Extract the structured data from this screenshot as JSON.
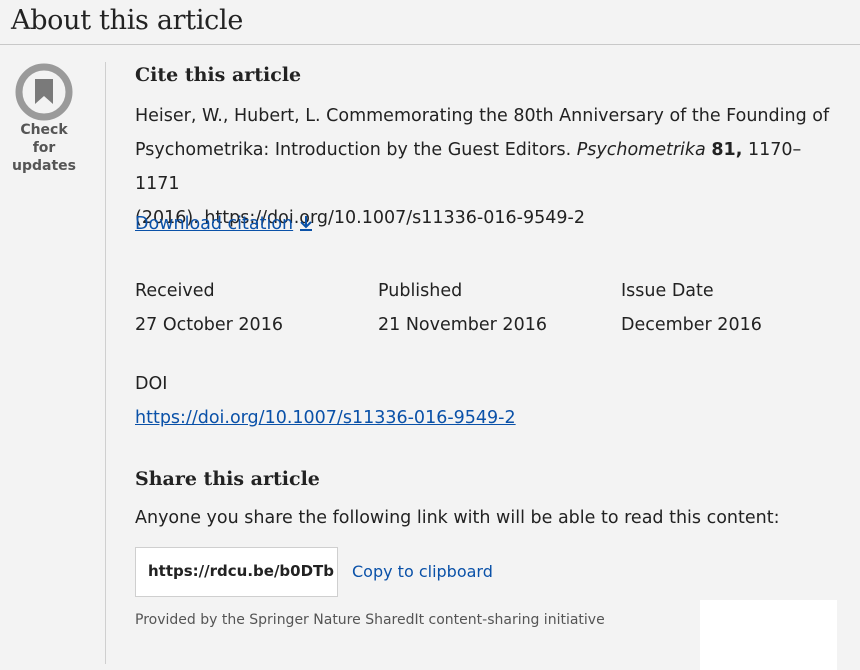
{
  "header": {
    "title": "About this article"
  },
  "badge": {
    "line1": "Check for",
    "line2": "updates",
    "icon": "crossmark-bookmark-icon"
  },
  "cite": {
    "heading": "Cite this article",
    "line1": "Heiser, W., Hubert, L. Commemorating the 80th Anniversary of the Founding of",
    "line2_pre": "Psychometrika: Introduction by the Guest Editors. ",
    "journal": "Psychometrika",
    "volume": "81,",
    "line2_post": " 1170–1171",
    "line3": "(2016). https://doi.org/10.1007/s11336-016-9549-2",
    "download_label": "Download citation",
    "download_icon": "download-arrow-icon"
  },
  "dates": [
    {
      "label": "Received",
      "value": "27 October 2016"
    },
    {
      "label": "Published",
      "value": "21 November 2016"
    },
    {
      "label": "Issue Date",
      "value": "December 2016"
    }
  ],
  "doi": {
    "label": "DOI",
    "link": "https://doi.org/10.1007/s11336-016-9549-2"
  },
  "share": {
    "heading": "Share this article",
    "text": "Anyone you share the following link with will be able to read this content:",
    "url": "https://rdcu.be/b0DTb",
    "copy_label": "Copy to clipboard",
    "provided": "Provided by the Springer Nature SharedIt content-sharing initiative"
  },
  "colors": {
    "link": "#0a51a8",
    "background": "#f3f3f3"
  }
}
